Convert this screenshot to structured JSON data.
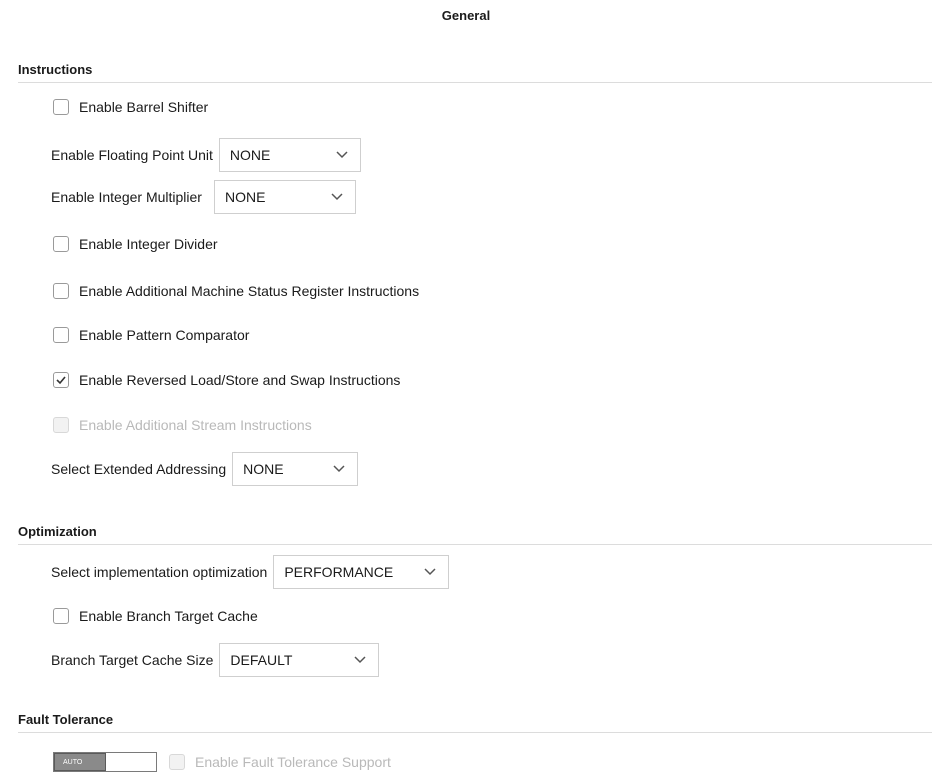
{
  "title": "General",
  "sections": {
    "instructions": "Instructions",
    "optimization": "Optimization",
    "fault_tolerance": "Fault Tolerance"
  },
  "instructions": {
    "barrel_shifter": {
      "label": "Enable Barrel Shifter",
      "checked": false
    },
    "fpu": {
      "label": "Enable Floating Point Unit",
      "value": "NONE"
    },
    "int_mult": {
      "label": "Enable Integer Multiplier",
      "value": "NONE"
    },
    "int_div": {
      "label": "Enable Integer Divider",
      "checked": false
    },
    "msr": {
      "label": "Enable Additional Machine Status Register Instructions",
      "checked": false
    },
    "pattern": {
      "label": "Enable Pattern Comparator",
      "checked": false
    },
    "reversed": {
      "label": "Enable Reversed Load/Store and Swap Instructions",
      "checked": true
    },
    "stream": {
      "label": "Enable Additional Stream Instructions",
      "checked": false,
      "disabled": true
    },
    "ext_addr": {
      "label": "Select Extended Addressing",
      "value": "NONE"
    }
  },
  "optimization": {
    "impl": {
      "label": "Select implementation optimization",
      "value": "PERFORMANCE"
    },
    "btc": {
      "label": "Enable Branch Target Cache",
      "checked": false
    },
    "btc_size": {
      "label": "Branch Target Cache Size",
      "value": "DEFAULT"
    }
  },
  "fault": {
    "toggle_label": "AUTO",
    "support": {
      "label": "Enable Fault Tolerance Support",
      "checked": false,
      "disabled": true
    }
  }
}
